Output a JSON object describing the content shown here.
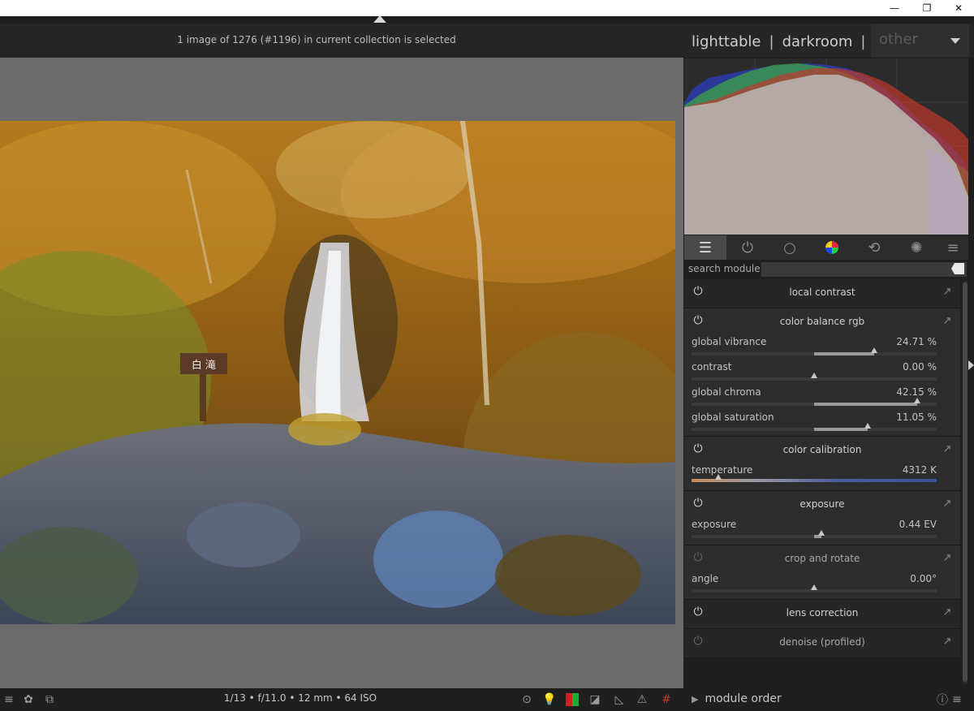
{
  "window": {
    "minimize_glyph": "—",
    "restore_glyph": "❐",
    "close_glyph": "✕"
  },
  "header": {
    "selection_info": "1 image of 1276 (#1196) in current collection is selected",
    "views": {
      "lighttable": "lighttable",
      "separator": "|",
      "darkroom": "darkroom",
      "other": "other"
    }
  },
  "photo": {
    "sign_text": "白 滝"
  },
  "bottom": {
    "exif": "1/13 • f/11.0 • 12 mm • 64 ISO",
    "module_order_label": "module order",
    "left_icons": [
      "list-icon",
      "styles-icon",
      "display-icon"
    ],
    "right_icons": [
      "focus-peaking-icon",
      "bulb-icon",
      "color-assessment-icon",
      "raw-overexposed-icon",
      "softproof-icon",
      "gamut-check-icon",
      "guides-icon"
    ]
  },
  "panel": {
    "module_tabs": [
      "active-modules-icon",
      "power-icon",
      "base-icon",
      "color-icon",
      "correct-icon",
      "effect-icon",
      "menu-icon"
    ],
    "search": {
      "label": "search module",
      "value": "",
      "placeholder": ""
    },
    "modules": [
      {
        "title": "local contrast",
        "enabled": true,
        "sliders": []
      },
      {
        "title": "color balance rgb",
        "enabled": true,
        "sliders": [
          {
            "label": "global vibrance",
            "value": "24.71 %",
            "fraction": 0.49
          },
          {
            "label": "contrast",
            "value": "0.00 %",
            "fraction": 0.0
          },
          {
            "label": "global chroma",
            "value": "42.15 %",
            "fraction": 0.84
          },
          {
            "label": "global saturation",
            "value": "11.05 %",
            "fraction": 0.44
          }
        ]
      },
      {
        "title": "color calibration",
        "enabled": true,
        "sliders": [
          {
            "label": "temperature",
            "value": "4312 K",
            "fraction": 0.11
          }
        ]
      },
      {
        "title": "exposure",
        "enabled": true,
        "sliders": [
          {
            "label": "exposure",
            "value": "0.44 EV",
            "fraction": 0.06
          }
        ]
      },
      {
        "title": "crop and rotate",
        "enabled": false,
        "sliders": [
          {
            "label": "angle",
            "value": "0.00°",
            "fraction": 0.0
          }
        ]
      },
      {
        "title": "lens correction",
        "enabled": true,
        "sliders": []
      },
      {
        "title": "denoise (profiled)",
        "enabled": false,
        "sliders": []
      }
    ]
  },
  "colors": {
    "panel_bg": "#1f1f1f",
    "center_bg": "#6b6b6b",
    "histogram_red": "#c0392b",
    "histogram_green": "#3faa3f",
    "histogram_blue": "#2b3fbf",
    "histogram_magenta": "#b23cc0"
  }
}
